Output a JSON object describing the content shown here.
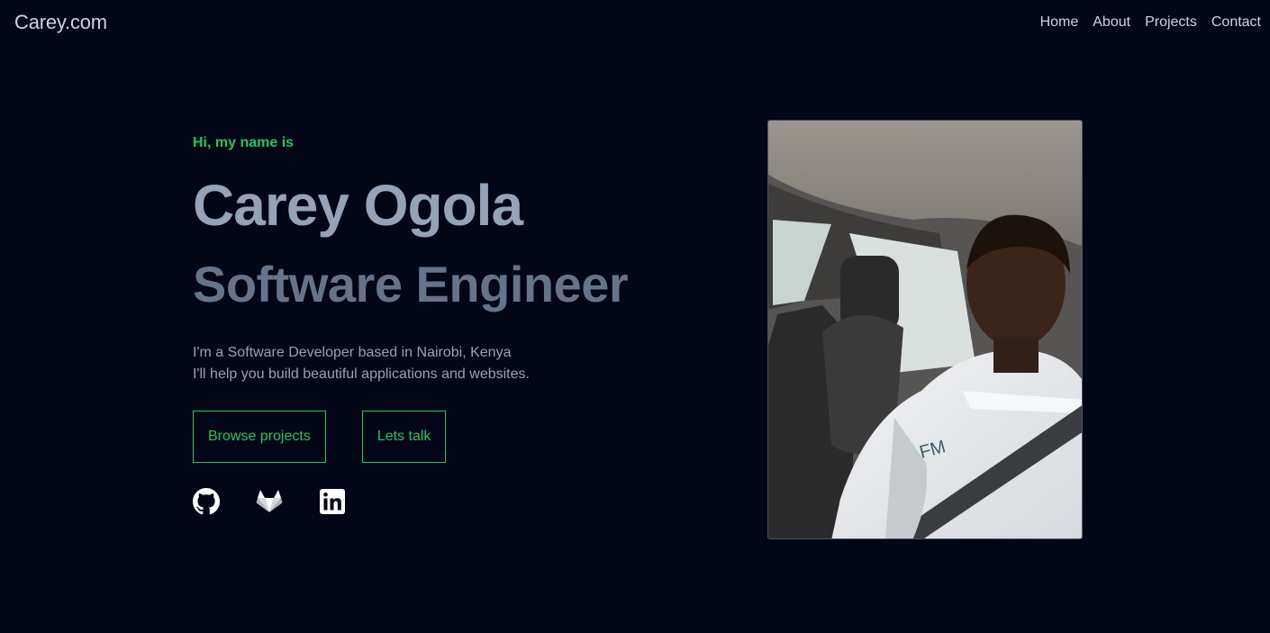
{
  "nav": {
    "brand": "Carey.com",
    "links": [
      "Home",
      "About",
      "Projects",
      "Contact"
    ]
  },
  "hero": {
    "greeting": "Hi, my name is",
    "name": "Carey Ogola",
    "role": "Software Engineer",
    "bio_line1": "I'm a Software Developer based in Nairobi, Kenya",
    "bio_line2": "I'll help you build beautiful applications and websites.",
    "buttons": {
      "browse": "Browse projects",
      "talk": "Lets talk"
    },
    "socials": [
      "github-icon",
      "gitlab-icon",
      "linkedin-icon"
    ]
  },
  "colors": {
    "background": "#030617",
    "accent": "#22c55e",
    "name": "#94a3b8",
    "role": "#64748b",
    "text": "#cbd5e1"
  }
}
